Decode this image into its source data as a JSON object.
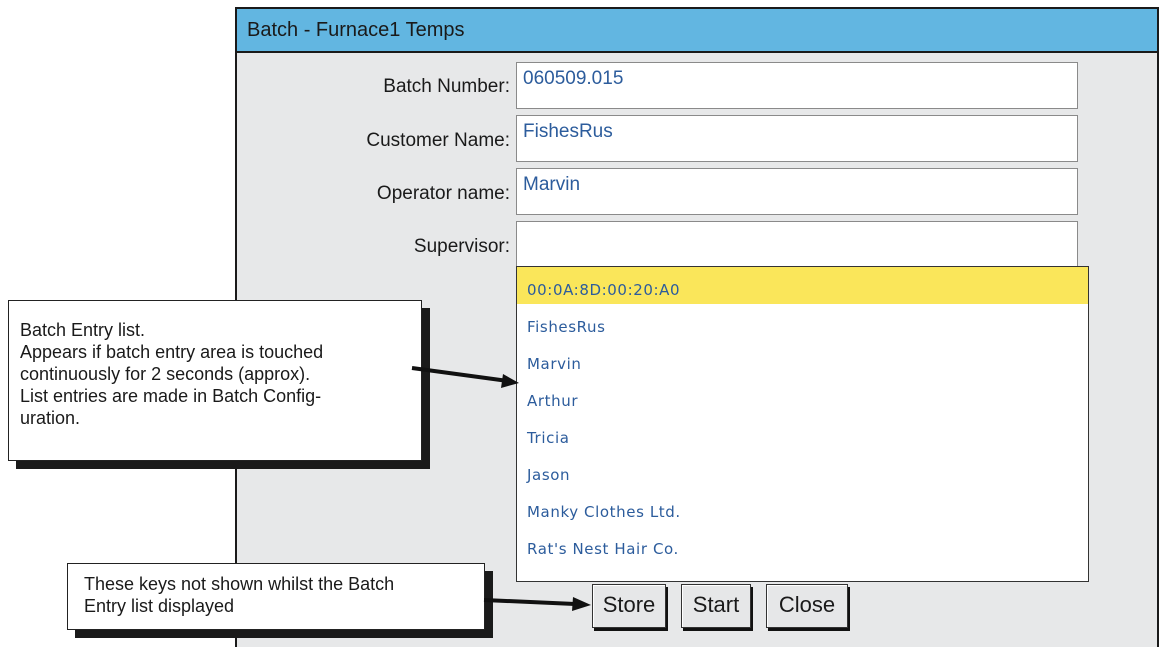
{
  "window": {
    "title": "Batch - Furnace1 Temps"
  },
  "form": {
    "batch_number": {
      "label": "Batch Number:",
      "value": "060509.015"
    },
    "customer_name": {
      "label": "Customer Name:",
      "value": "FishesRus"
    },
    "operator_name": {
      "label": "Operator name:",
      "value": "Marvin"
    },
    "supervisor": {
      "label": "Supervisor:",
      "value": ""
    }
  },
  "batch_entry_list": {
    "selected_index": 0,
    "items": [
      "00:0A:8D:00:20:A0",
      "FishesRus",
      "Marvin",
      "Arthur",
      "Tricia",
      "Jason",
      "Manky Clothes Ltd.",
      "Rat's Nest Hair Co."
    ]
  },
  "buttons": {
    "store": "Store",
    "start": "Start",
    "close": "Close"
  },
  "annotations": {
    "list_note": [
      "Batch Entry list.",
      "Appears if batch entry area is touched",
      "continuously for 2 seconds (approx).",
      "List entries are made in Batch Config-",
      "uration."
    ],
    "keys_note": [
      "These keys not shown whilst the Batch",
      "Entry list displayed"
    ]
  },
  "colors": {
    "title_bar": "#62b6e1",
    "selected_item": "#fae65a",
    "field_text": "#2c5c9c",
    "window_bg": "#e7e8e9"
  }
}
